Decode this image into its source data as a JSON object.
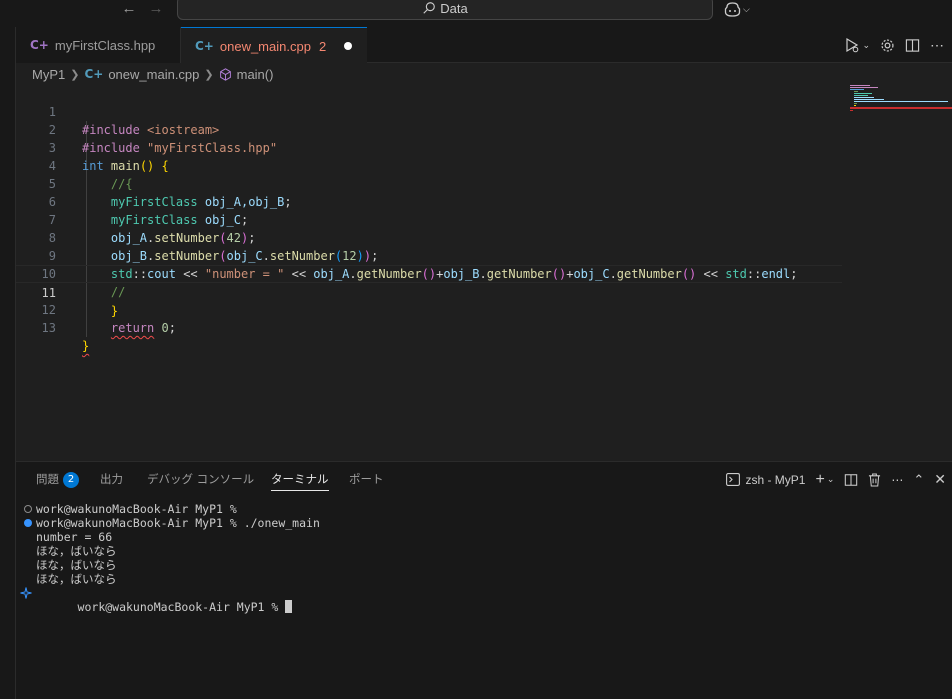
{
  "titlebar": {
    "search_label": "Data",
    "back_icon": "arrow-left-icon",
    "forward_icon": "arrow-right-icon",
    "copilot_icon": "copilot-icon"
  },
  "tabs": [
    {
      "label": "myFirstClass.hpp",
      "icon": "cpp-file-icon"
    },
    {
      "label": "onew_main.cpp",
      "problems": "2",
      "icon": "cpp-file-icon"
    }
  ],
  "breadcrumb": [
    "MyP1",
    "onew_main.cpp",
    "main()"
  ],
  "editor": {
    "line_numbers": [
      "1",
      "2",
      "3",
      "4",
      "5",
      "6",
      "7",
      "8",
      "9",
      "10",
      "11",
      "12",
      "13"
    ],
    "current_line": "11",
    "code": {
      "l1_directive": "#include",
      "l1_header": " <iostream>",
      "l2_directive": "#include",
      "l2_header": " \"myFirstClass.hpp\"",
      "l3_type": "int",
      "l3_fn": "main",
      "l4_comment": "//{",
      "l5_class": "myFirstClass",
      "l5_vars": "obj_A,obj_B",
      "l6_class": "myFirstClass",
      "l6_var": "obj_C",
      "l7_obj": "obj_A",
      "l7_method": "setNumber",
      "l7_arg": "42",
      "l8_obj": "obj_B",
      "l8_method": "setNumber",
      "l8_obj2": "obj_C",
      "l8_method2": "setNumber",
      "l8_arg": "12",
      "l9_ns": "std",
      "l9_cout": "cout",
      "l9_str": "\"number = \"",
      "l9_a": "obj_A",
      "l9_b": "obj_B",
      "l9_c": "obj_C",
      "l9_get": "getNumber",
      "l9_endl": "endl",
      "l10_comment": "//",
      "l12_return": "return",
      "l12_num": "0"
    }
  },
  "panel": {
    "tabs": [
      "問題",
      "出力",
      "デバッグ コンソール",
      "ターミナル",
      "ポート"
    ],
    "problems_count": "2",
    "active_tab": "ターミナル",
    "terminal_name": "zsh - MyP1"
  },
  "terminal": {
    "lines": [
      "work@wakunoMacBook-Air MyP1 %",
      "work@wakunoMacBook-Air MyP1 % ./onew_main",
      "number = 66",
      "ほな，ばいなら",
      "ほな，ばいなら",
      "ほな，ばいなら",
      "work@wakunoMacBook-Air MyP1 % "
    ]
  },
  "colors": {
    "accent": "#0078d4",
    "error": "#f48771",
    "background": "#1f1f1f"
  }
}
